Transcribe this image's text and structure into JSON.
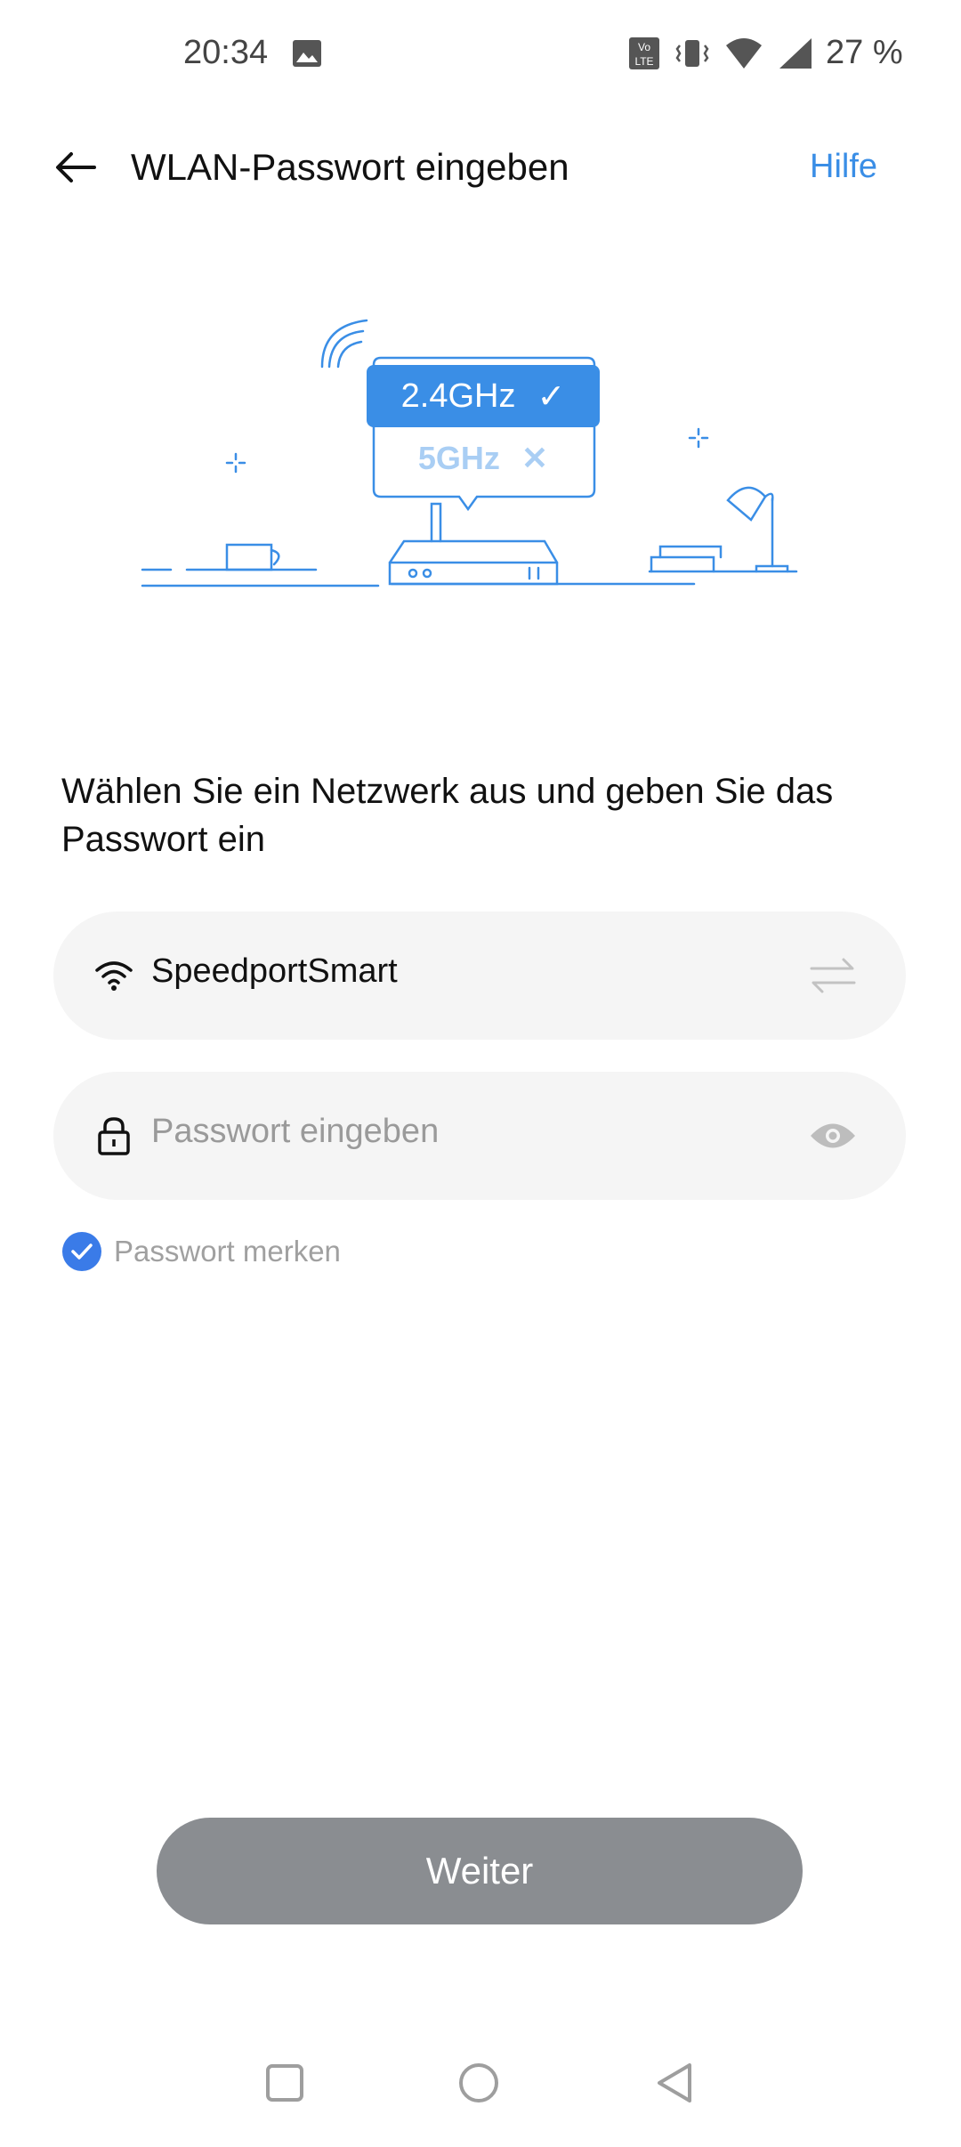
{
  "status_bar": {
    "time": "20:34",
    "battery": "27 %",
    "icons": [
      "gallery-icon",
      "volte-icon",
      "vibrate-icon",
      "wifi-icon",
      "signal-icon"
    ]
  },
  "header": {
    "title": "WLAN-Passwort eingeben",
    "help_label": "Hilfe"
  },
  "illustration": {
    "band_ok": "2.4GHz",
    "band_ok_mark": "✓",
    "band_bad": "5GHz",
    "band_bad_mark": "✕"
  },
  "instruction": "Wählen Sie ein Netzwerk aus und geben Sie das Passwort ein",
  "ssid_field": {
    "value": "SpeedportSmart"
  },
  "password_field": {
    "placeholder": "Passwort eingeben"
  },
  "remember": {
    "label": "Passwort merken",
    "checked": true
  },
  "next_button": {
    "label": "Weiter"
  },
  "colors": {
    "accent": "#3a8ee6",
    "button_disabled": "#8a8d91",
    "field_bg": "#f5f5f5"
  }
}
